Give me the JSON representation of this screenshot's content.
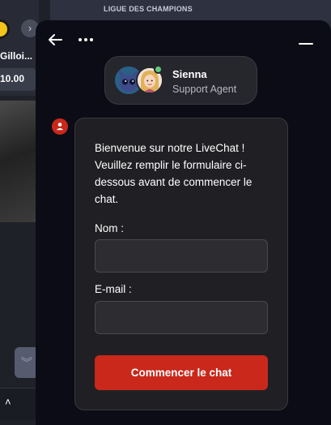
{
  "background": {
    "league_header": "LIGUE DES CHAMPIONS",
    "team_name": "Gilloi...",
    "odd_value": "10.00",
    "chevron_glyph": "›",
    "scroll_glyph": "︾",
    "caret_glyph": "˄"
  },
  "chat": {
    "agent": {
      "name": "Sienna",
      "role": "Support Agent",
      "status": "online",
      "status_color": "#5ecc7b"
    },
    "header_icons": {
      "back": "arrow-left-icon",
      "more": "more-dots-icon",
      "minimize": "minimize-icon"
    },
    "welcome_message": "Bienvenue sur notre LiveChat ! Veuillez remplir le formulaire ci-dessous avant de commencer le chat.",
    "form": {
      "name_label": "Nom :",
      "name_value": "",
      "email_label": "E-mail :",
      "email_value": "",
      "submit_label": "Commencer le chat"
    },
    "colors": {
      "accent": "#c9281b",
      "widget_bg": "#0c0c16",
      "card_bg": "#202024"
    }
  }
}
